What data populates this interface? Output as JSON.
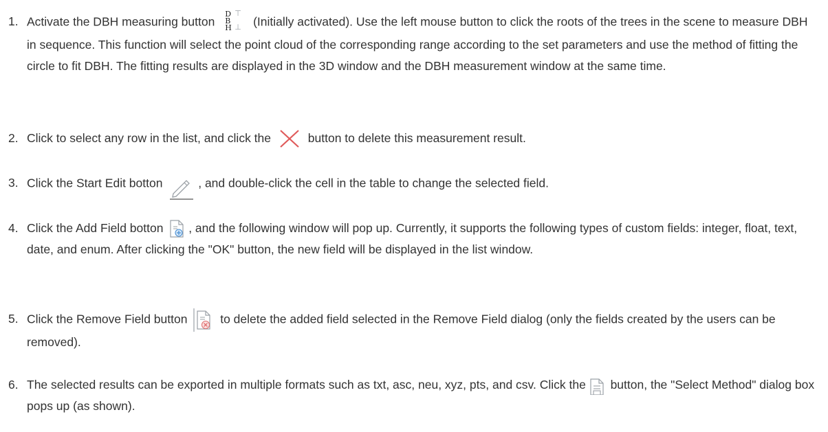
{
  "steps": [
    {
      "number": "1.",
      "before": "Activate the DBH measuring button",
      "icon": "dbh-measure-icon",
      "icon_letters": [
        "D",
        "B",
        "H"
      ],
      "after": "(Initially activated). Use the left mouse button to click the roots of the trees in the scene to measure DBH in sequence. This function will select the point cloud of the corresponding range according to the set parameters and use the method of fitting the circle to fit DBH. The fitting results are displayed in the 3D window and the DBH measurement window at the same time."
    },
    {
      "number": "2.",
      "before": "Click to select any row in the list, and click the",
      "icon": "delete-x-icon",
      "after": "button to delete this measurement result."
    },
    {
      "number": "3.",
      "before": "Click the Start Edit botton",
      "icon": "pencil-edit-icon",
      "after": ", and double-click the cell in the table to change the selected field."
    },
    {
      "number": "4.",
      "before": "Click the Add Field botton",
      "icon": "add-field-icon",
      "after": ", and the following window will pop up. Currently, it supports the following types of custom fields: integer, float, text, date, and enum. After clicking the \"OK\" button, the new field will be displayed in the list window."
    },
    {
      "number": "5.",
      "before": "Click the Remove Field button",
      "icon": "remove-field-icon",
      "after": "to delete the added field selected in the Remove Field dialog (only the fields created by the users can be removed)."
    },
    {
      "number": "6.",
      "before": "The selected results can be exported in multiple formats such as txt, asc, neu, xyz, pts, and csv. Click the",
      "icon": "export-document-icon",
      "after": "button, the \"Select Method\" dialog box pops up (as shown)."
    }
  ],
  "colors": {
    "text": "#333333",
    "delete_icon": "#e05a5a",
    "remove_badge": "#e07070",
    "add_badge": "#4a8fd4",
    "icon_outline": "#9aa0a6"
  }
}
